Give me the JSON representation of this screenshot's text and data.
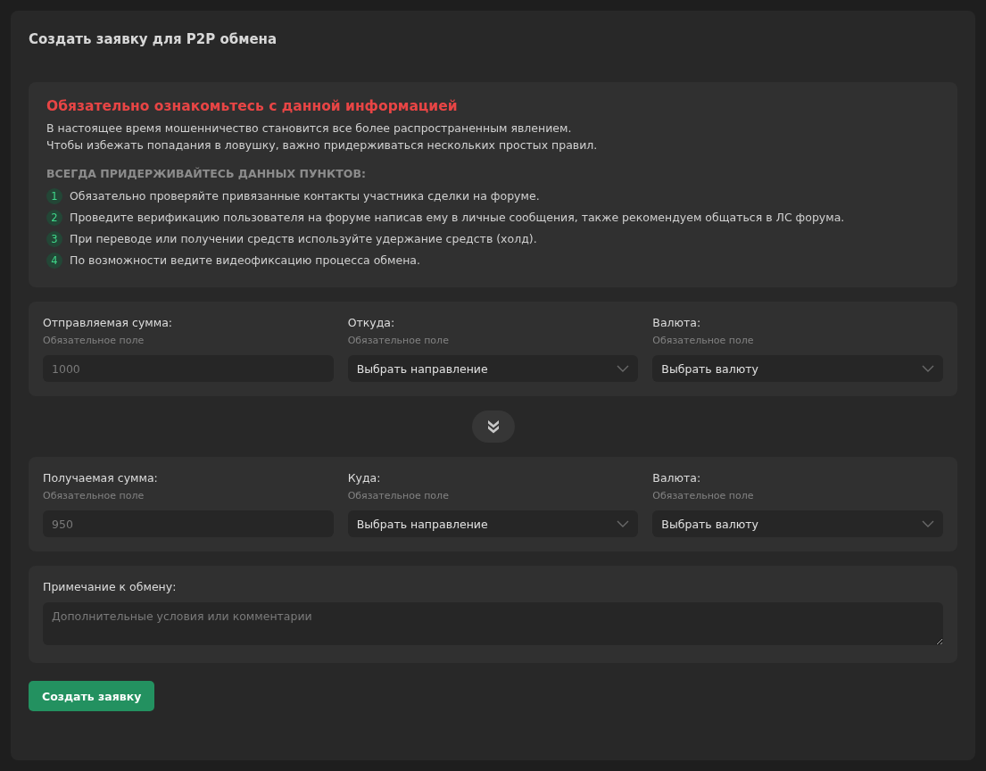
{
  "title": "Создать заявку для P2P обмена",
  "notice": {
    "heading": "Обязательно ознакомьтесь с данной информацией",
    "lines": [
      "В настоящее время мошенничество становится все более распространенным явлением.",
      "Чтобы избежать попадания в ловушку, важно придерживаться нескольких простых правил."
    ],
    "rules_heading": "ВСЕГДА ПРИДЕРЖИВАЙТЕСЬ ДАННЫХ ПУНКТОВ:",
    "rules": [
      {
        "number": "1",
        "text": "Обязательно проверяйте привязанные контакты участника сделки на форуме."
      },
      {
        "number": "2",
        "text": "Проведите верификацию пользователя на форуме написав ему в личные сообщения, также рекомендуем общаться в ЛС форума."
      },
      {
        "number": "3",
        "text": "При переводе или получении средств используйте удержание средств (холд)."
      },
      {
        "number": "4",
        "text": "По возможности ведите видеофиксацию процесса обмена."
      }
    ]
  },
  "sections": [
    {
      "fields": [
        {
          "kind": "input",
          "label": "Отправляемая сумма:",
          "hint": "Обязательное поле",
          "placeholder": "1000"
        },
        {
          "kind": "select",
          "label": "Откуда:",
          "hint": "Обязательное поле",
          "value": "Выбрать направление"
        },
        {
          "kind": "select",
          "label": "Валюта:",
          "hint": "Обязательное поле",
          "value": "Выбрать валюту"
        }
      ]
    },
    {
      "fields": [
        {
          "kind": "input",
          "label": "Получаемая сумма:",
          "hint": "Обязательное поле",
          "placeholder": "950"
        },
        {
          "kind": "select",
          "label": "Куда:",
          "hint": "Обязательное поле",
          "value": "Выбрать направление"
        },
        {
          "kind": "select",
          "label": "Валюта:",
          "hint": "Обязательное поле",
          "value": "Выбрать валюту"
        }
      ]
    }
  ],
  "note": {
    "label": "Примечание к обмену:",
    "placeholder": "Дополнительные условия или комментарии"
  },
  "submit": "Создать заявку"
}
